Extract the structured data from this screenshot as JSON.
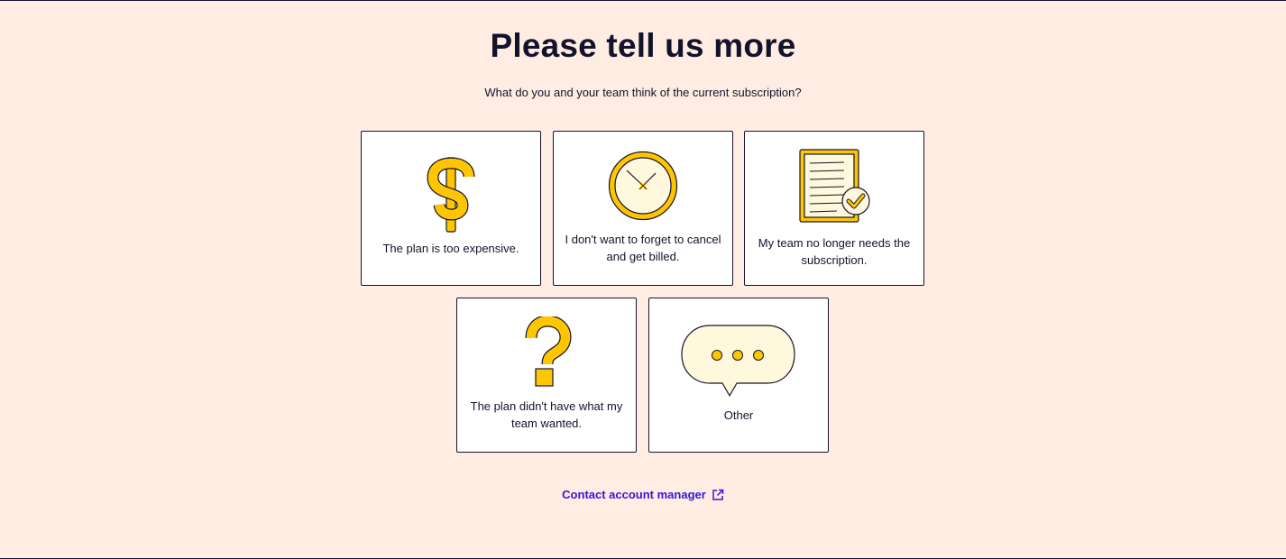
{
  "header": {
    "title": "Please tell us more",
    "subtitle": "What do you and your team think of the current subscription?"
  },
  "options": [
    {
      "icon": "dollar-sign-icon",
      "label": "The plan is too expensive."
    },
    {
      "icon": "clock-icon",
      "label": "I don't want to forget to cancel and get billed."
    },
    {
      "icon": "document-check-icon",
      "label": "My team no longer needs the subscription."
    },
    {
      "icon": "question-mark-icon",
      "label": "The plan didn't have what my team wanted."
    },
    {
      "icon": "chat-bubble-icon",
      "label": "Other"
    }
  ],
  "footer": {
    "contact_label": "Contact account manager",
    "contact_icon": "external-link-icon"
  },
  "colors": {
    "background": "#ffede3",
    "ink": "#13132b",
    "accent_yellow": "#ffc600",
    "pale_yellow": "#fff8dc",
    "link": "#3a15d6"
  }
}
